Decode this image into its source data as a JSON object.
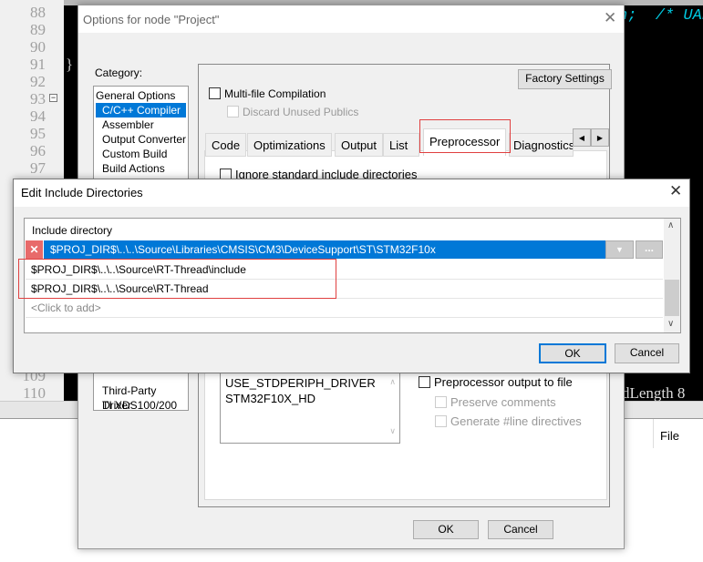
{
  "editor": {
    "line_numbers": [
      "88",
      "89",
      "90",
      "91",
      "92",
      "93",
      "94",
      "95",
      "96",
      "97",
      "109",
      "110"
    ],
    "code_fragment_top": "n;  /* UAR",
    "code_fragment_bottom": "dLength 8",
    "brace": "}",
    "bottom_panel_label": "File"
  },
  "options_dialog": {
    "title": "Options for node \"Project\"",
    "category_label": "Category:",
    "categories": [
      "General Options",
      "C/C++ Compiler",
      "Assembler",
      "Output Converter",
      "Custom Build",
      "Build Actions",
      "Third-Party Driver",
      "TI XDS100/200"
    ],
    "selected_category": "C/C++ Compiler",
    "factory_settings": "Factory Settings",
    "multi_file": "Multi-file Compilation",
    "discard_unused": "Discard Unused Publics",
    "tabs": [
      "Code",
      "Optimizations",
      "Output",
      "List",
      "Preprocessor",
      "Diagnostics"
    ],
    "active_tab": "Preprocessor",
    "ignore_std": "Ignore standard include directories",
    "defines": [
      "USE_STDPERIPH_DRIVER",
      "STM32F10X_HD"
    ],
    "pp_output": "Preprocessor output to file",
    "preserve_comments": "Preserve comments",
    "generate_line": "Generate #line directives",
    "ok": "OK",
    "cancel": "Cancel"
  },
  "include_dialog": {
    "title": "Edit Include Directories",
    "header": "Include directory",
    "selected_row": "$PROJ_DIR$\\..\\..\\Source\\Libraries\\CMSIS\\CM3\\DeviceSupport\\ST\\STM32F10x",
    "rows": [
      "$PROJ_DIR$\\..\\..\\Source\\RT-Thread\\include",
      "$PROJ_DIR$\\..\\..\\Source\\RT-Thread"
    ],
    "placeholder": "<Click to add>",
    "browse": "...",
    "ok": "OK",
    "cancel": "Cancel"
  },
  "colors": {
    "selection": "#0078d7",
    "highlight_box": "#e04040",
    "code_bg": "#000000",
    "code_cyan": "#00c8e0"
  }
}
